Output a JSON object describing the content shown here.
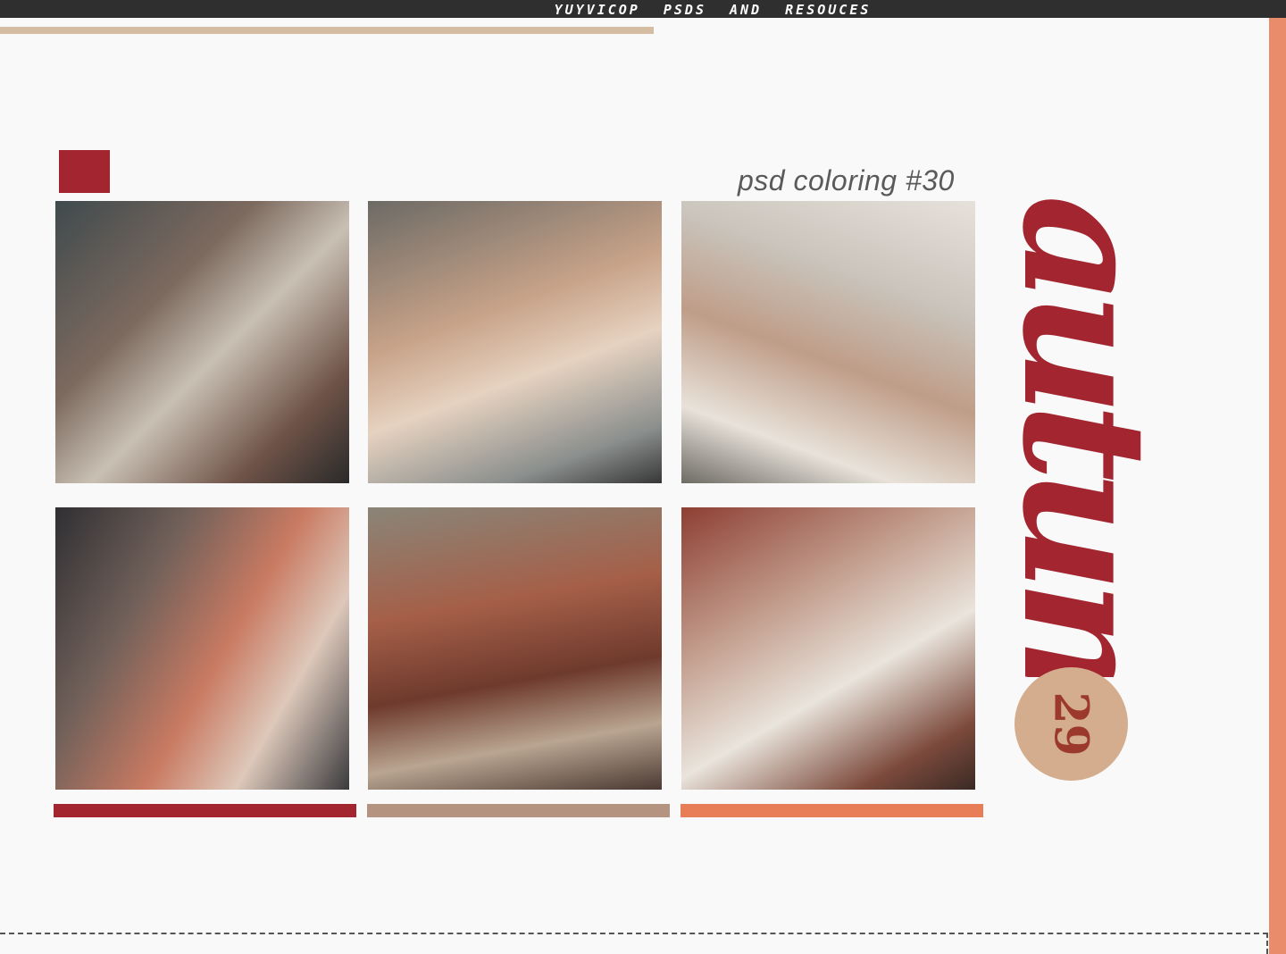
{
  "header": {
    "text": "YUYVICOP PSDS AND RESOUCES"
  },
  "subtitle": "psd coloring #30",
  "title": "autumn",
  "badge": {
    "number": "29"
  },
  "photos": [
    {
      "name": "photo-1"
    },
    {
      "name": "photo-2"
    },
    {
      "name": "photo-3"
    },
    {
      "name": "photo-4"
    },
    {
      "name": "photo-5"
    },
    {
      "name": "photo-6"
    }
  ],
  "swatches": [
    "#a3252f",
    "#b59381",
    "#e77e57"
  ],
  "colors": {
    "accent": "#a3252f",
    "tan": "#d5bda3",
    "coral": "#e88c6c",
    "badge": "#d3ad8e"
  }
}
